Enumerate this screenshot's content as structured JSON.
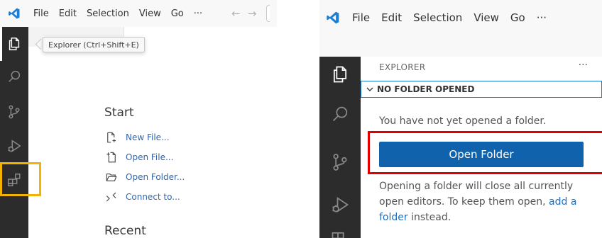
{
  "left_panel": {
    "menu": [
      "File",
      "Edit",
      "Selection",
      "View",
      "Go",
      "···"
    ],
    "nav": {
      "back": "←",
      "forward": "→"
    },
    "tooltip": "Explorer (Ctrl+Shift+E)",
    "start": {
      "title": "Start",
      "items": [
        "New File...",
        "Open File...",
        "Open Folder...",
        "Connect to..."
      ]
    },
    "recent_title": "Recent"
  },
  "right_panel": {
    "menu": [
      "File",
      "Edit",
      "Selection",
      "View",
      "Go",
      "···"
    ],
    "explorer": {
      "title": "EXPLORER",
      "more": "···",
      "section": "NO FOLDER OPENED",
      "message": "You have not yet opened a folder.",
      "button": "Open Folder",
      "note_before": "Opening a folder will close all currently open editors. To keep them open, ",
      "note_link": "add a folder",
      "note_after": " instead."
    }
  },
  "colors": {
    "activity_bar": "#2c2c2c",
    "accent_blue": "#0f62ab",
    "link": "#1f6fbf",
    "highlight_yellow": "#f2b400",
    "highlight_red": "#e00000"
  },
  "icons": [
    "vscode-logo-icon",
    "explorer-icon",
    "search-icon",
    "source-control-icon",
    "run-debug-icon",
    "extensions-icon",
    "new-file-icon",
    "open-file-icon",
    "open-folder-icon",
    "remote-connect-icon",
    "chevron-down-icon"
  ]
}
